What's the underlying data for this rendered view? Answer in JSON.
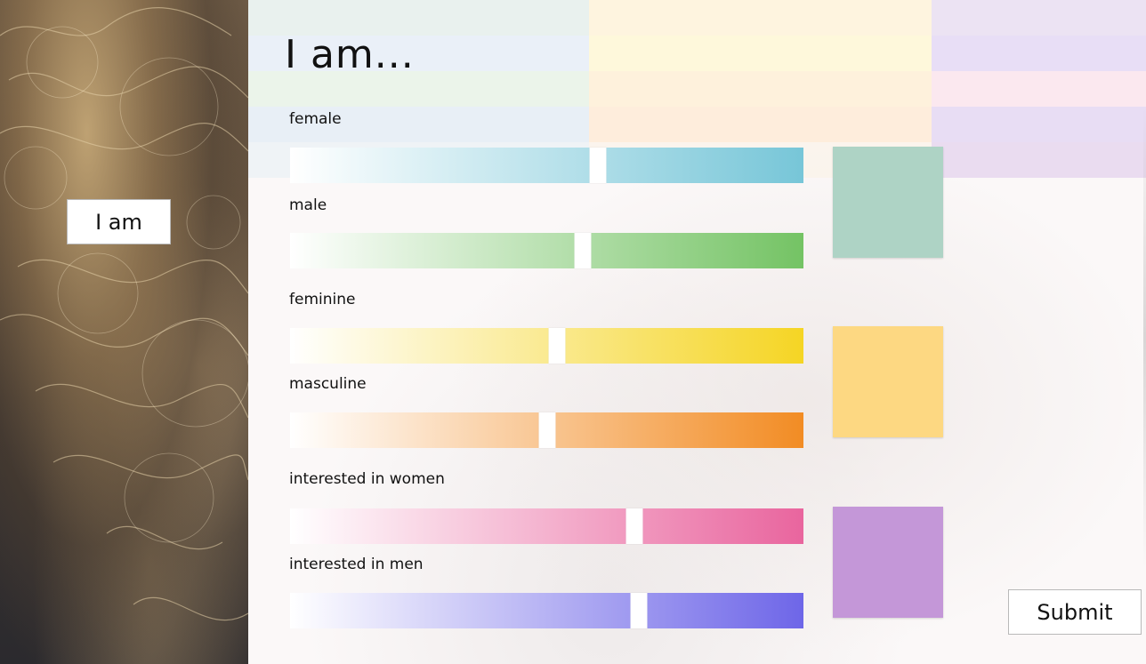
{
  "sidebar": {
    "button_label": "I am"
  },
  "page": {
    "title": "I am..."
  },
  "sliders": [
    {
      "label": "female",
      "value": 0.6,
      "color_from": "#ffffff",
      "color_to": "#77c6d8"
    },
    {
      "label": "male",
      "value": 0.57,
      "color_from": "#ffffff",
      "color_to": "#74c364"
    },
    {
      "label": "feminine",
      "value": 0.52,
      "color_from": "#ffffff",
      "color_to": "#f5d524"
    },
    {
      "label": "masculine",
      "value": 0.5,
      "color_from": "#ffffff",
      "color_to": "#f28c24"
    },
    {
      "label": "interested in women",
      "value": 0.67,
      "color_from": "#ffffff",
      "color_to": "#e9659e"
    },
    {
      "label": "interested in men",
      "value": 0.68,
      "color_from": "#ffffff",
      "color_to": "#6e66e8"
    }
  ],
  "swatches": [
    {
      "name": "gender-swatch",
      "color": "#aed3c5"
    },
    {
      "name": "expression-swatch",
      "color": "#fdd882"
    },
    {
      "name": "attraction-swatch",
      "color": "#c497d8"
    }
  ],
  "actions": {
    "submit_label": "Submit"
  }
}
